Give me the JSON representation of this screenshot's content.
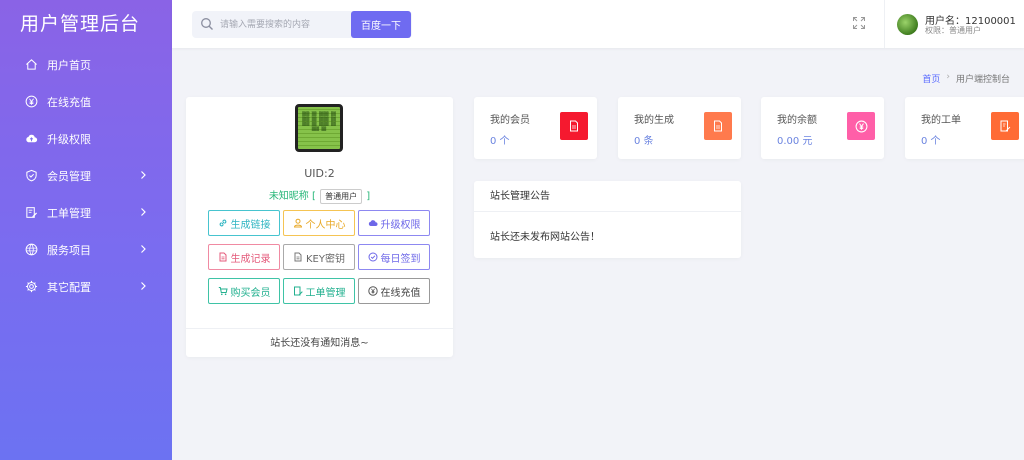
{
  "brand": {
    "title": "用户管理后台"
  },
  "sidebar": {
    "items": [
      {
        "label": "用户首页",
        "icon": "home-icon"
      },
      {
        "label": "在线充值",
        "icon": "yen-coin-icon"
      },
      {
        "label": "升级权限",
        "icon": "cloud-upload-icon"
      },
      {
        "label": "会员管理",
        "icon": "shield-check-icon",
        "has_submenu": true
      },
      {
        "label": "工单管理",
        "icon": "ticket-edit-icon",
        "has_submenu": true
      },
      {
        "label": "服务项目",
        "icon": "globe-icon",
        "has_submenu": true
      },
      {
        "label": "其它配置",
        "icon": "gear-icon",
        "has_submenu": true
      }
    ]
  },
  "header": {
    "search": {
      "placeholder": "请输入需要搜索的内容",
      "button_label": "百度一下"
    },
    "user": {
      "name_label": "用户名：12100001",
      "role_label": "权限：普通用户"
    }
  },
  "breadcrumb": {
    "home": "首页",
    "current": "用户端控制台"
  },
  "profile": {
    "uid": "UID:2",
    "nickname": "未知昵称",
    "level_badge": "普通用户",
    "buttons": [
      {
        "label": "生成链接",
        "icon": "link-icon",
        "color": "#2fb5c2"
      },
      {
        "label": "个人中心",
        "icon": "user-icon",
        "color": "#e8a928"
      },
      {
        "label": "升级权限",
        "icon": "cloud-upload-icon",
        "color": "#6d67e8"
      },
      {
        "label": "生成记录",
        "icon": "document-icon",
        "color": "#e45a7b"
      },
      {
        "label": "KEY密钥",
        "icon": "file-icon",
        "color": "#666666"
      },
      {
        "label": "每日签到",
        "icon": "check-circle-icon",
        "color": "#6d67e8"
      },
      {
        "label": "购买会员",
        "icon": "cart-icon",
        "color": "#22b08f"
      },
      {
        "label": "工单管理",
        "icon": "ticket-edit-icon",
        "color": "#22b08f"
      },
      {
        "label": "在线充值",
        "icon": "yen-coin-icon",
        "color": "#444444"
      }
    ],
    "footer_message": "站长还没有通知消息~"
  },
  "stats": [
    {
      "label": "我的会员",
      "value": "0 个",
      "icon": "vip-card-icon",
      "color": "#f5192f"
    },
    {
      "label": "我的生成",
      "value": "0 条",
      "icon": "document-icon",
      "color": "#ff7a4d"
    },
    {
      "label": "我的余额",
      "value": "0.00 元",
      "icon": "yen-coin-icon",
      "color": "#ff5fa8"
    },
    {
      "label": "我的工单",
      "value": "0 个",
      "icon": "ticket-edit-icon",
      "color": "#ff6b35"
    }
  ],
  "notice": {
    "title": "站长管理公告",
    "body": "站长还未发布网站公告！"
  },
  "colors": {
    "accent": "#6f6bf1",
    "sidebar_top": "#8a63e6",
    "sidebar_bottom": "#6c72f2",
    "link": "#5b6cff"
  }
}
